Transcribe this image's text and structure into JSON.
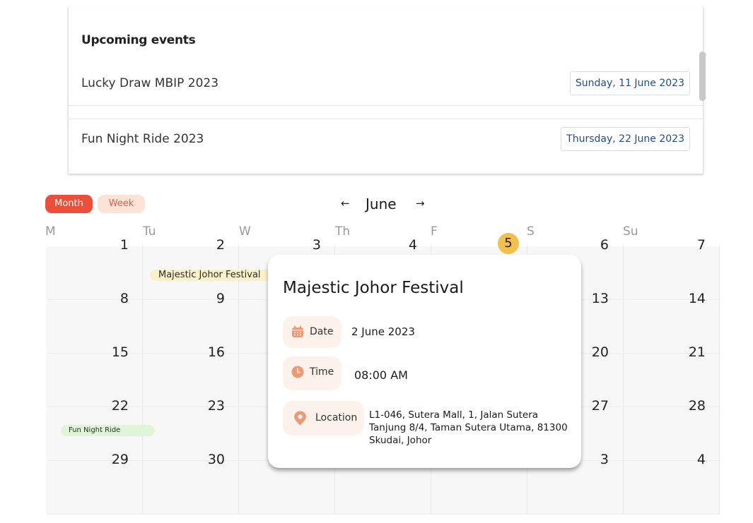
{
  "upcoming": {
    "heading": "Upcoming events",
    "events": [
      {
        "name": "Lucky Draw MBIP 2023",
        "date": "Sunday, 11 June 2023"
      },
      {
        "name": "Fun Night Ride 2023",
        "date": "Thursday, 22 June 2023"
      }
    ]
  },
  "views": {
    "month": "Month",
    "week": "Week",
    "active": "Month"
  },
  "nav": {
    "prev": "←",
    "next": "→",
    "month": "June"
  },
  "weekdays": [
    "M",
    "Tu",
    "W",
    "Th",
    "F",
    "S",
    "Su"
  ],
  "weeks": [
    [
      "1",
      "2",
      "3",
      "4",
      "5",
      "6",
      "7"
    ],
    [
      "8",
      "9",
      "",
      "",
      "",
      "13",
      "14"
    ],
    [
      "15",
      "16",
      "",
      "",
      "",
      "20",
      "21"
    ],
    [
      "22",
      "23",
      "",
      "",
      "",
      "27",
      "28"
    ],
    [
      "29",
      "30",
      "",
      "",
      "",
      "3",
      "4"
    ]
  ],
  "calendar_events": {
    "majestic": "Majestic Johor Festival",
    "fun_night": "Fun Night Ride"
  },
  "popup": {
    "title": "Majestic Johor Festival",
    "date_label": "Date",
    "date_value": "2 June 2023",
    "time_label": "Time",
    "time_value": "08:00 AM",
    "location_label": "Location",
    "location_value": "L1-046, Sutera Mall, 1, Jalan Sutera Tanjung 8/4, Taman Sutera Utama, 81300 Skudai, Johor"
  },
  "colors": {
    "accent": "#ea4f3a",
    "accent_light": "#fde3d6",
    "today": "#f2c14d",
    "icon": "#ec9a76",
    "date_text": "#1e4b8f"
  }
}
